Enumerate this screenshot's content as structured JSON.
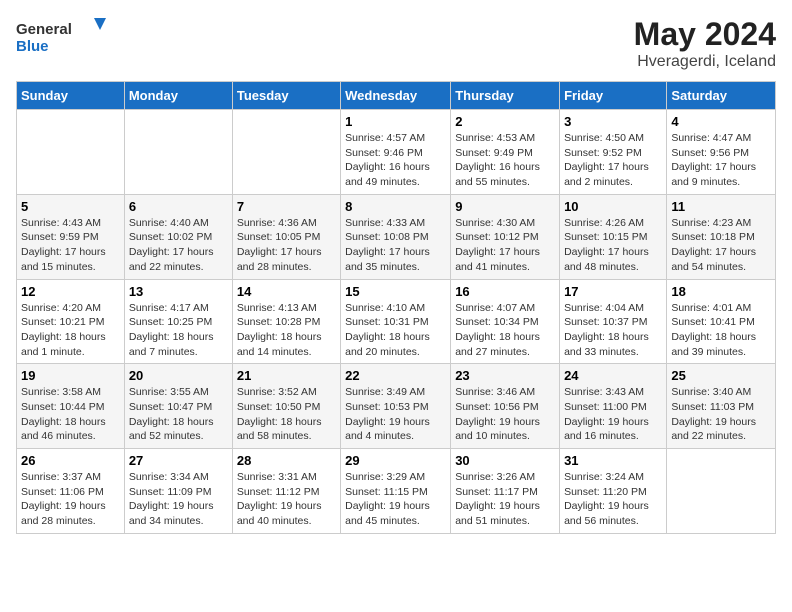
{
  "header": {
    "logo_general": "General",
    "logo_blue": "Blue",
    "month_title": "May 2024",
    "location": "Hveragerdi, Iceland"
  },
  "days_of_week": [
    "Sunday",
    "Monday",
    "Tuesday",
    "Wednesday",
    "Thursday",
    "Friday",
    "Saturday"
  ],
  "weeks": [
    [
      {
        "day": "",
        "info": ""
      },
      {
        "day": "",
        "info": ""
      },
      {
        "day": "",
        "info": ""
      },
      {
        "day": "1",
        "info": "Sunrise: 4:57 AM\nSunset: 9:46 PM\nDaylight: 16 hours and 49 minutes."
      },
      {
        "day": "2",
        "info": "Sunrise: 4:53 AM\nSunset: 9:49 PM\nDaylight: 16 hours and 55 minutes."
      },
      {
        "day": "3",
        "info": "Sunrise: 4:50 AM\nSunset: 9:52 PM\nDaylight: 17 hours and 2 minutes."
      },
      {
        "day": "4",
        "info": "Sunrise: 4:47 AM\nSunset: 9:56 PM\nDaylight: 17 hours and 9 minutes."
      }
    ],
    [
      {
        "day": "5",
        "info": "Sunrise: 4:43 AM\nSunset: 9:59 PM\nDaylight: 17 hours and 15 minutes."
      },
      {
        "day": "6",
        "info": "Sunrise: 4:40 AM\nSunset: 10:02 PM\nDaylight: 17 hours and 22 minutes."
      },
      {
        "day": "7",
        "info": "Sunrise: 4:36 AM\nSunset: 10:05 PM\nDaylight: 17 hours and 28 minutes."
      },
      {
        "day": "8",
        "info": "Sunrise: 4:33 AM\nSunset: 10:08 PM\nDaylight: 17 hours and 35 minutes."
      },
      {
        "day": "9",
        "info": "Sunrise: 4:30 AM\nSunset: 10:12 PM\nDaylight: 17 hours and 41 minutes."
      },
      {
        "day": "10",
        "info": "Sunrise: 4:26 AM\nSunset: 10:15 PM\nDaylight: 17 hours and 48 minutes."
      },
      {
        "day": "11",
        "info": "Sunrise: 4:23 AM\nSunset: 10:18 PM\nDaylight: 17 hours and 54 minutes."
      }
    ],
    [
      {
        "day": "12",
        "info": "Sunrise: 4:20 AM\nSunset: 10:21 PM\nDaylight: 18 hours and 1 minute."
      },
      {
        "day": "13",
        "info": "Sunrise: 4:17 AM\nSunset: 10:25 PM\nDaylight: 18 hours and 7 minutes."
      },
      {
        "day": "14",
        "info": "Sunrise: 4:13 AM\nSunset: 10:28 PM\nDaylight: 18 hours and 14 minutes."
      },
      {
        "day": "15",
        "info": "Sunrise: 4:10 AM\nSunset: 10:31 PM\nDaylight: 18 hours and 20 minutes."
      },
      {
        "day": "16",
        "info": "Sunrise: 4:07 AM\nSunset: 10:34 PM\nDaylight: 18 hours and 27 minutes."
      },
      {
        "day": "17",
        "info": "Sunrise: 4:04 AM\nSunset: 10:37 PM\nDaylight: 18 hours and 33 minutes."
      },
      {
        "day": "18",
        "info": "Sunrise: 4:01 AM\nSunset: 10:41 PM\nDaylight: 18 hours and 39 minutes."
      }
    ],
    [
      {
        "day": "19",
        "info": "Sunrise: 3:58 AM\nSunset: 10:44 PM\nDaylight: 18 hours and 46 minutes."
      },
      {
        "day": "20",
        "info": "Sunrise: 3:55 AM\nSunset: 10:47 PM\nDaylight: 18 hours and 52 minutes."
      },
      {
        "day": "21",
        "info": "Sunrise: 3:52 AM\nSunset: 10:50 PM\nDaylight: 18 hours and 58 minutes."
      },
      {
        "day": "22",
        "info": "Sunrise: 3:49 AM\nSunset: 10:53 PM\nDaylight: 19 hours and 4 minutes."
      },
      {
        "day": "23",
        "info": "Sunrise: 3:46 AM\nSunset: 10:56 PM\nDaylight: 19 hours and 10 minutes."
      },
      {
        "day": "24",
        "info": "Sunrise: 3:43 AM\nSunset: 11:00 PM\nDaylight: 19 hours and 16 minutes."
      },
      {
        "day": "25",
        "info": "Sunrise: 3:40 AM\nSunset: 11:03 PM\nDaylight: 19 hours and 22 minutes."
      }
    ],
    [
      {
        "day": "26",
        "info": "Sunrise: 3:37 AM\nSunset: 11:06 PM\nDaylight: 19 hours and 28 minutes."
      },
      {
        "day": "27",
        "info": "Sunrise: 3:34 AM\nSunset: 11:09 PM\nDaylight: 19 hours and 34 minutes."
      },
      {
        "day": "28",
        "info": "Sunrise: 3:31 AM\nSunset: 11:12 PM\nDaylight: 19 hours and 40 minutes."
      },
      {
        "day": "29",
        "info": "Sunrise: 3:29 AM\nSunset: 11:15 PM\nDaylight: 19 hours and 45 minutes."
      },
      {
        "day": "30",
        "info": "Sunrise: 3:26 AM\nSunset: 11:17 PM\nDaylight: 19 hours and 51 minutes."
      },
      {
        "day": "31",
        "info": "Sunrise: 3:24 AM\nSunset: 11:20 PM\nDaylight: 19 hours and 56 minutes."
      },
      {
        "day": "",
        "info": ""
      }
    ]
  ]
}
